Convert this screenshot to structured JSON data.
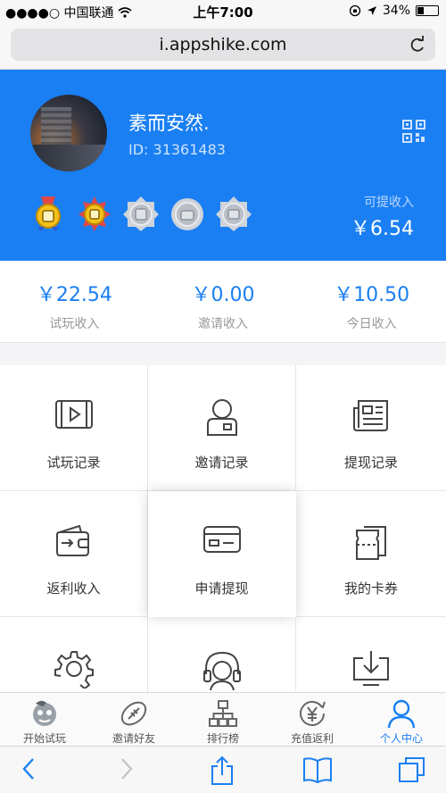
{
  "status_bar": {
    "carrier": "●●●●○ 中国联通",
    "time": "上午7:00",
    "battery": "34%",
    "battery_level": 0.34
  },
  "browser": {
    "url": "i.appshike.com"
  },
  "profile": {
    "name": "素而安然.",
    "id_text": "ID: 31361483",
    "withdrawable_label": "可提收入",
    "withdrawable_value": "￥6.54"
  },
  "badges": [
    {
      "icon": "gold-medal-badge-icon",
      "earned": true
    },
    {
      "icon": "gold-star-badge-icon",
      "earned": true
    },
    {
      "icon": "silver-badge-icon",
      "earned": false
    },
    {
      "icon": "silver-badge-icon",
      "earned": false
    },
    {
      "icon": "silver-badge-icon",
      "earned": false
    }
  ],
  "stats": [
    {
      "value": "￥22.54",
      "label": "试玩收入"
    },
    {
      "value": "￥0.00",
      "label": "邀请收入"
    },
    {
      "value": "￥10.50",
      "label": "今日收入"
    }
  ],
  "menu": [
    {
      "label": "试玩记录",
      "icon": "video-play-icon"
    },
    {
      "label": "邀请记录",
      "icon": "user-icon"
    },
    {
      "label": "提现记录",
      "icon": "newspaper-icon"
    },
    {
      "label": "返利收入",
      "icon": "wallet-icon"
    },
    {
      "label": "申请提现",
      "icon": "credit-card-icon"
    },
    {
      "label": "我的卡券",
      "icon": "ticket-icon"
    },
    {
      "label": "",
      "icon": "gear-icon"
    },
    {
      "label": "",
      "icon": "headset-icon"
    },
    {
      "label": "",
      "icon": "download-icon"
    }
  ],
  "tabs": [
    {
      "label": "开始试玩",
      "icon": "mascot-icon",
      "active": false
    },
    {
      "label": "邀请好友",
      "icon": "football-icon",
      "active": false
    },
    {
      "label": "排行榜",
      "icon": "hierarchy-icon",
      "active": false
    },
    {
      "label": "充值返利",
      "icon": "yen-coin-icon",
      "active": false
    },
    {
      "label": "个人中心",
      "icon": "person-icon",
      "active": true
    }
  ],
  "colors": {
    "accent": "#1a7ff2",
    "header_bg": "#1a7ff2"
  }
}
